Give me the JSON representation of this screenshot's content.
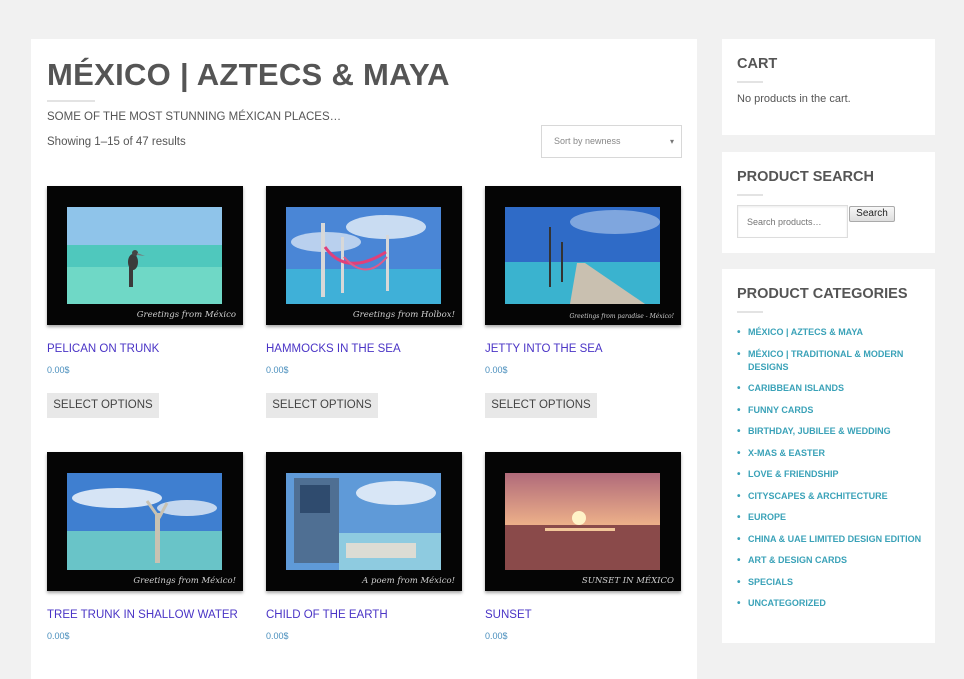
{
  "page": {
    "title": "MÉXICO | AZTECS & MAYA",
    "subtitle": "SOME OF THE MOST STUNNING MÉXICAN PLACES…",
    "result_count": "Showing 1–15 of 47 results",
    "sort_label": "Sort by newness",
    "sort_arrow": "▾"
  },
  "products": [
    {
      "name": "PELICAN ON TRUNK",
      "price": "0.00$",
      "button": "SELECT OPTIONS",
      "caption": "Greetings from México"
    },
    {
      "name": "HAMMOCKS IN THE SEA",
      "price": "0.00$",
      "button": "SELECT OPTIONS",
      "caption": "Greetings from Holbox!"
    },
    {
      "name": "JETTY INTO THE SEA",
      "price": "0.00$",
      "button": "SELECT OPTIONS",
      "caption": "Greetings from paradise - México!"
    },
    {
      "name": "TREE TRUNK IN SHALLOW WATER",
      "price": "0.00$",
      "caption": "Greetings from México!"
    },
    {
      "name": "CHILD OF THE EARTH",
      "price": "0.00$",
      "caption": "A poem from México!"
    },
    {
      "name": "SUNSET",
      "price": "0.00$",
      "caption": "SUNSET IN MÉXICO"
    }
  ],
  "cart": {
    "title": "CART",
    "empty_text": "No products in the cart."
  },
  "search": {
    "title": "PRODUCT SEARCH",
    "placeholder": "Search products…",
    "button": "Search"
  },
  "categories": {
    "title": "PRODUCT CATEGORIES",
    "items": [
      "MÉXICO | AZTECS & MAYA",
      "MÉXICO | TRADITIONAL & MODERN DESIGNS",
      "CARIBBEAN ISLANDS",
      "FUNNY CARDS",
      "BIRTHDAY, JUBILEE & WEDDING",
      "X-MAS & EASTER",
      "LOVE & FRIENDSHIP",
      "CITYSCAPES & ARCHITECTURE",
      "EUROPE",
      "CHINA & UAE LIMITED DESIGN EDITION",
      "ART & DESIGN CARDS",
      "SPECIALS",
      "UNCATEGORIZED"
    ]
  },
  "colors": {
    "link_purple": "#4a34c6",
    "price_blue": "#4a8fbd",
    "category_teal": "#3aa2b8",
    "button_gray": "#e8e8e8"
  }
}
